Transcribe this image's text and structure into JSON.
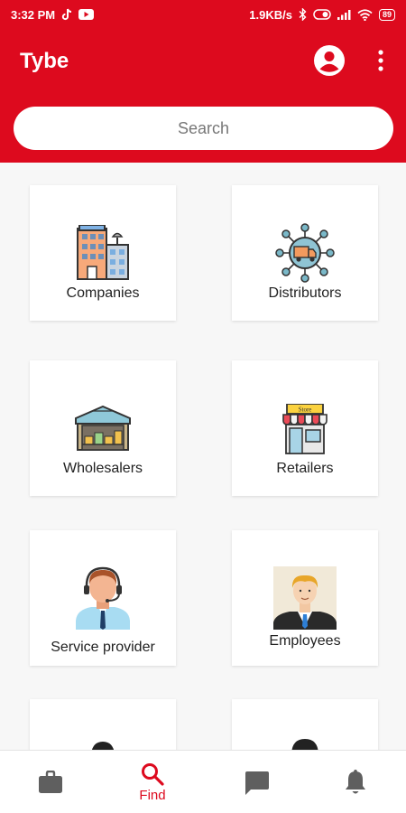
{
  "status_bar": {
    "time": "3:32 PM",
    "network_speed": "1.9KB/s",
    "battery": "89",
    "icons": [
      "tiktok-icon",
      "youtube-icon",
      "bluetooth-icon",
      "alarm-icon",
      "signal-icon",
      "wifi-icon",
      "battery-icon"
    ]
  },
  "app_bar": {
    "title": "Tybe",
    "icons": [
      "account-circle-icon",
      "more-vert-icon"
    ]
  },
  "search": {
    "placeholder": "Search"
  },
  "categories": [
    {
      "label": "Companies",
      "icon": "office-buildings-icon"
    },
    {
      "label": "Distributors",
      "icon": "distribution-truck-icon"
    },
    {
      "label": "Wholesalers",
      "icon": "warehouse-icon"
    },
    {
      "label": "Retailers",
      "icon": "store-icon"
    },
    {
      "label": "Service provider",
      "icon": "support-agent-icon"
    },
    {
      "label": "Employees",
      "icon": "businessman-icon"
    },
    {
      "label": "",
      "icon": "person-icon"
    },
    {
      "label": "",
      "icon": "person-icon"
    }
  ],
  "bottom_nav": {
    "items": [
      {
        "label": "",
        "icon": "briefcase-icon",
        "active": false
      },
      {
        "label": "Find",
        "icon": "search-icon",
        "active": true
      },
      {
        "label": "",
        "icon": "chat-icon",
        "active": false
      },
      {
        "label": "",
        "icon": "notification-bell-icon",
        "active": false
      }
    ]
  },
  "colors": {
    "brand": "#dd0a1e",
    "background": "#f7f7f7",
    "inactive_icon": "#5f5f5f"
  }
}
